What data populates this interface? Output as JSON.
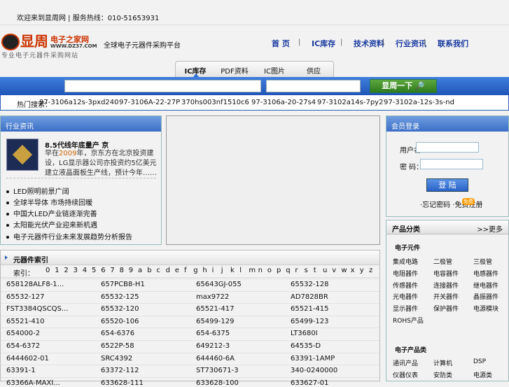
{
  "topbar": {
    "text": "欢迎来到显周网 | 服务热线：010-51653931"
  },
  "header": {
    "logo": {
      "zhou": "显周",
      "site": "电子之家网",
      "url": "WWW.DZ37.COM",
      "tagline": "专业电子元器件采购网站"
    },
    "slogan": "全球电子元器件采购平台",
    "nav": [
      "首  页",
      "IC库存",
      "技术资料",
      "行业资讯",
      "联系我们"
    ]
  },
  "search": {
    "tabs": [
      "IC库存",
      "PDF资料",
      "IC图片",
      "供应"
    ],
    "button": "显周一下",
    "hot_label": "热门搜索：",
    "hot": [
      "97-3106a12s-3pxd240",
      "97-3106A-22-27P",
      "370hs003nf1510c6",
      "97-3106a-20-27s4",
      "97-3102a14s-7py2",
      "97-3102a-12s-3s-nd"
    ]
  },
  "news": {
    "title": "行业资讯",
    "headline": "8.5代线年底量产 京",
    "body_pre": "早在",
    "body_year": "2009",
    "body_post": "年，京东方在北京投资建设，LG显示器公司亦投资约5亿美元建立液晶面板生产线，预计今年……",
    "items": [
      "LED照明前景广阔",
      "全球半导体 市场持续回暖",
      "中国大LED产业链逐渐完善",
      "太阳能光伏产业迎来新机遇",
      "电子元器件行业未来发展趋势分析报告"
    ]
  },
  "login": {
    "title": "会员登录",
    "user_label": "用户名：",
    "pass_label": "密  码：",
    "button": "登  陆",
    "links": "·忘记密码  ·免费注册",
    "free": "免费"
  },
  "categories": {
    "title": "产品分类",
    "more": ">>更多",
    "section1": "电子元件",
    "items1": [
      "集成电路",
      "二极管",
      "三极管",
      "电阻器件",
      "电容器件",
      "电感器件",
      "传感器件",
      "连接器件",
      "继电器件",
      "光电器件",
      "开关器件",
      "晶振器件",
      "显示器件",
      "保护器件",
      "电源模块",
      "ROHS产品"
    ],
    "section2": "电子产品类",
    "items2": [
      "通讯产品",
      "计算机",
      "DSP",
      "仪器仪表",
      "安防类",
      "电源类"
    ]
  },
  "parts": {
    "title": "元器件索引",
    "alpha_label": "索引：",
    "alphabet": [
      "0",
      "1",
      "2",
      "3",
      "4",
      "5",
      "6",
      "7",
      "8",
      "9",
      "a",
      "b",
      "c",
      "d",
      "e",
      "f",
      "g",
      "h",
      "i",
      "j",
      "k",
      "l",
      "m",
      "n",
      "o",
      "p",
      "q",
      "r",
      "s",
      "t",
      "u",
      "v",
      "w",
      "x",
      "y",
      "z"
    ],
    "rows": [
      [
        "658128ALF8-1...",
        "657PCB8-H1",
        "65643GJ-055",
        "65532-128"
      ],
      [
        "65532-127",
        "65532-125",
        "max9722",
        "AD7828BR"
      ],
      [
        "FST3384QSCQS...",
        "65532-120",
        "65521-417",
        "65521-415"
      ],
      [
        "65521-410",
        "65520-106",
        "65499-129",
        "65499-123"
      ],
      [
        "654000-2",
        "654-6376",
        "654-6375",
        "LT3680I"
      ],
      [
        "654-6372",
        "6522P-58",
        "649212-3",
        "64535-D"
      ],
      [
        "6444602-01",
        "SRC4392",
        "644460-6A",
        "63391-1AMP"
      ],
      [
        "63391-1",
        "63372-112",
        "ST730671-3",
        "340-0240000"
      ],
      [
        "63366A-MAXI...",
        "633628-111",
        "633628-100",
        "633627-01"
      ]
    ]
  }
}
